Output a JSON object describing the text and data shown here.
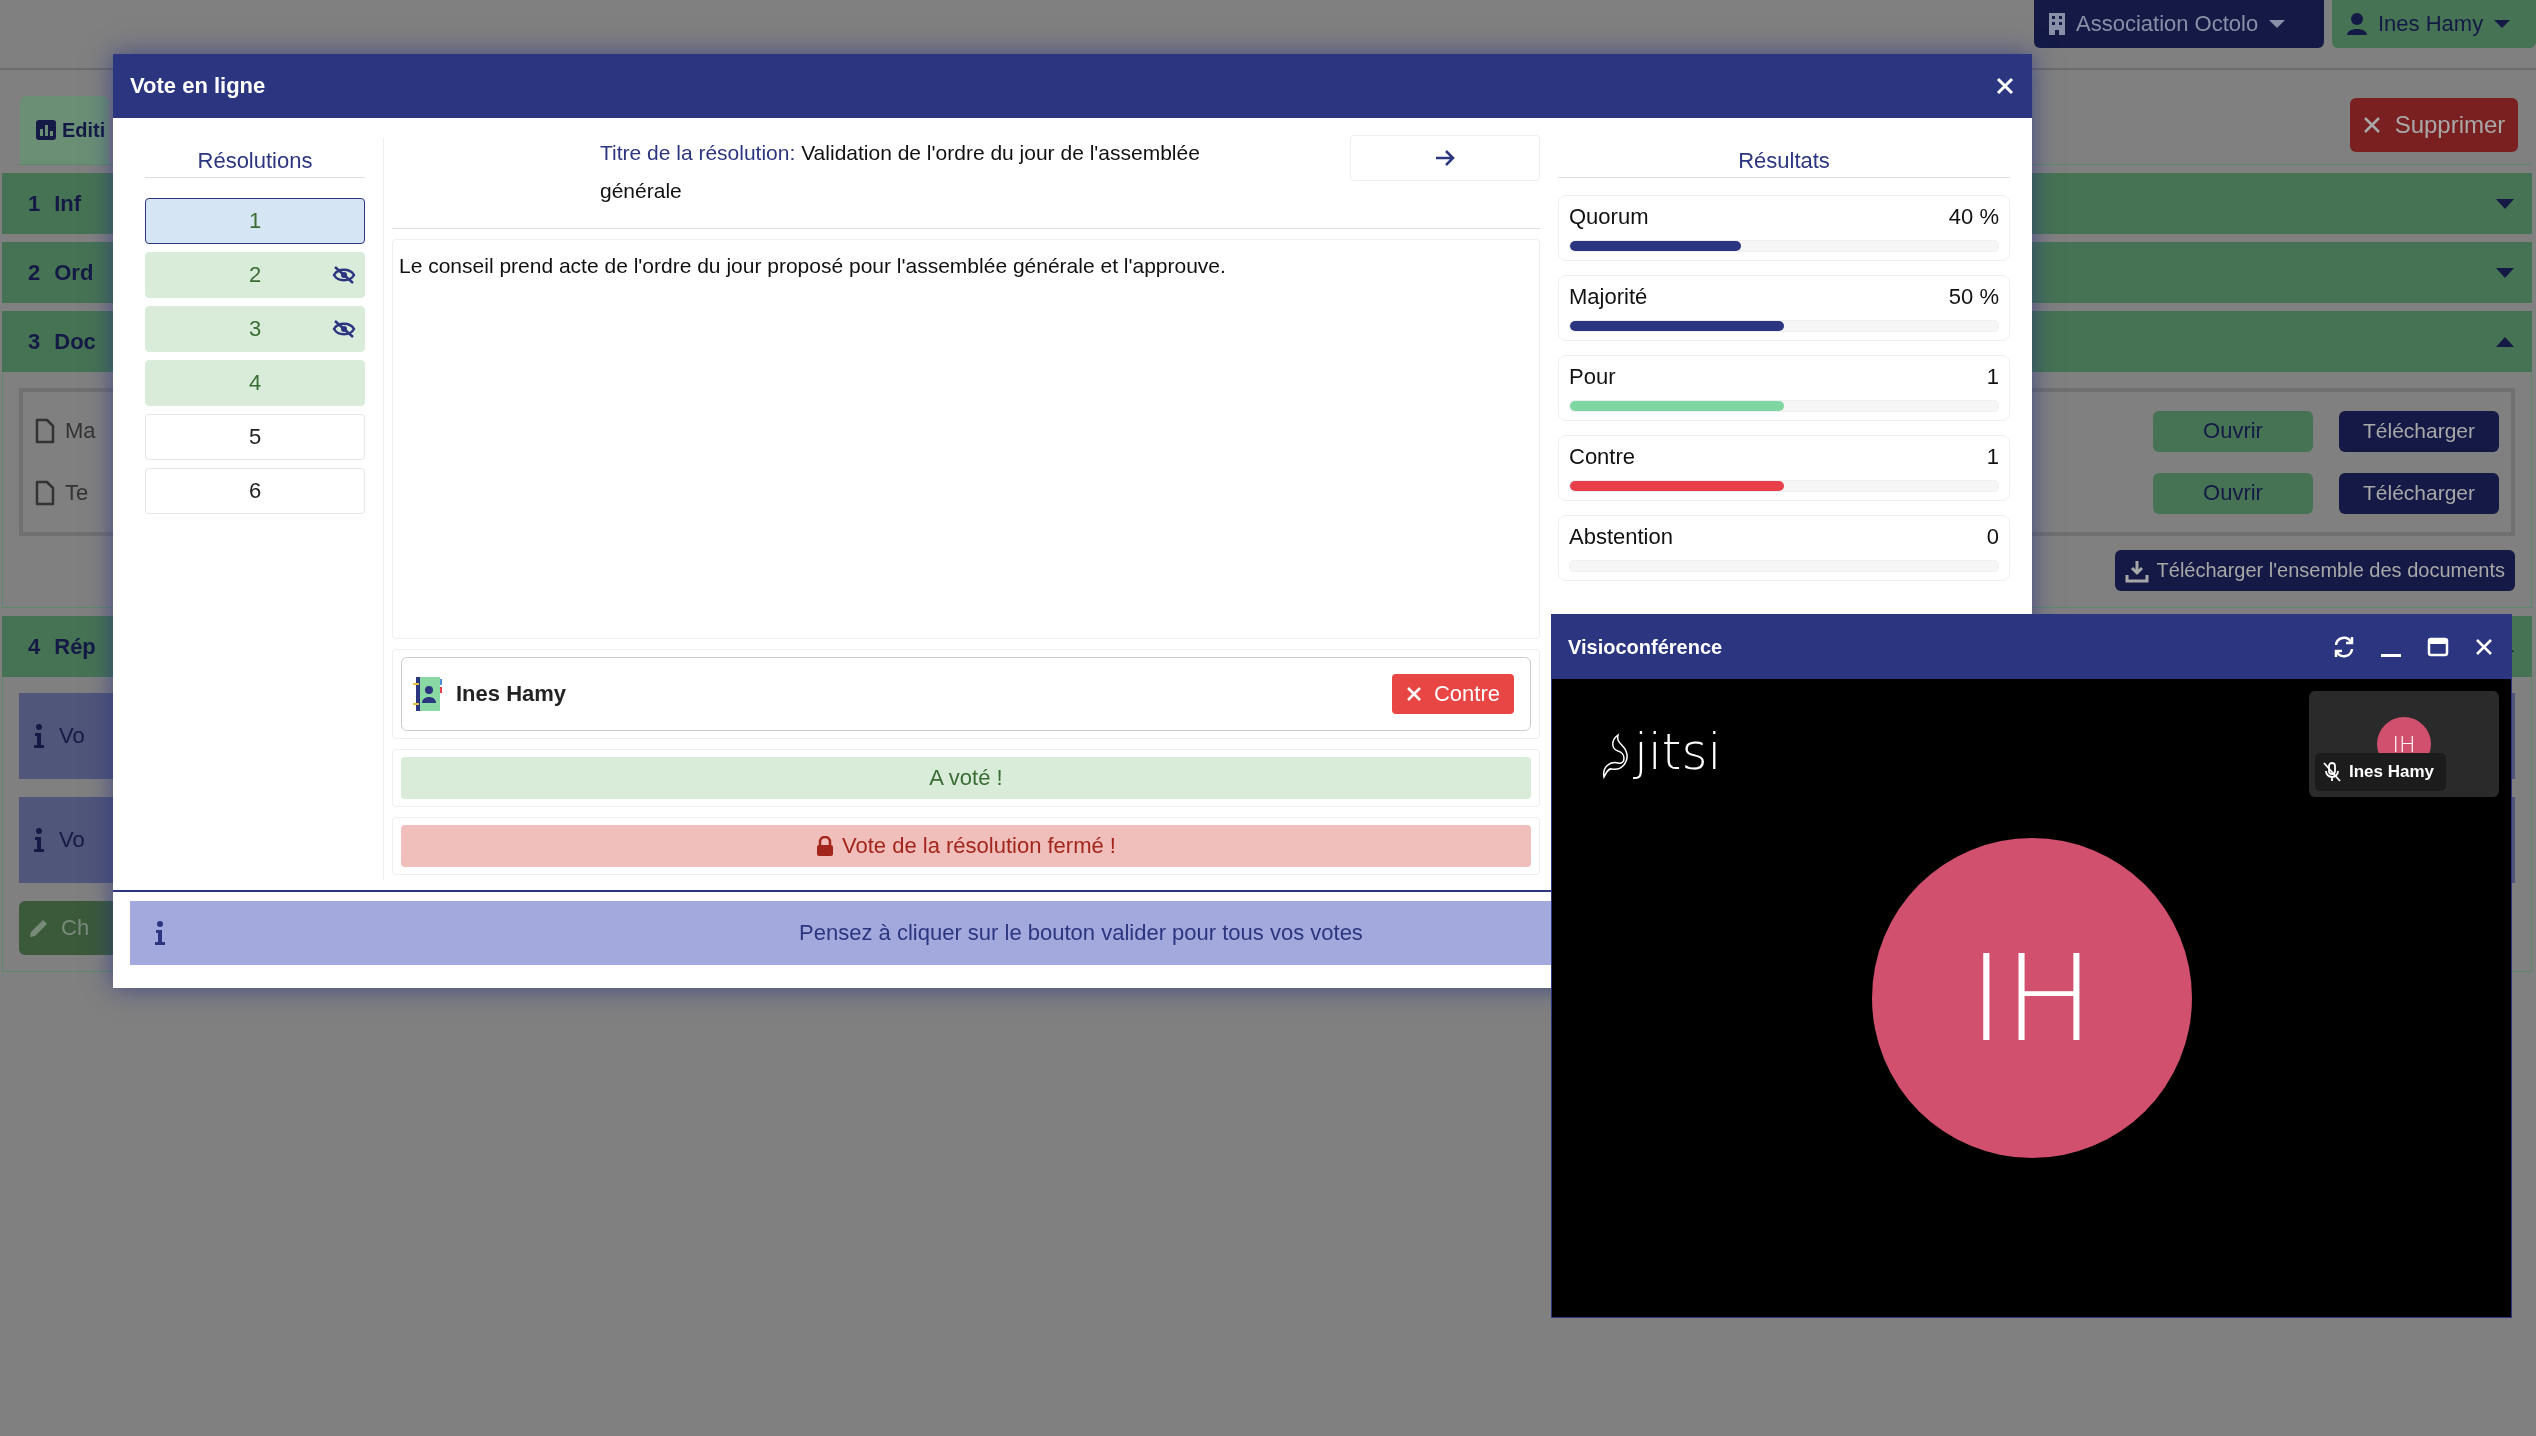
{
  "header": {
    "organization_button": "Association Octolo",
    "user_button": "Ines Hamy"
  },
  "page": {
    "tab": "Editi",
    "delete_button": "Supprimer",
    "sections": [
      {
        "number": "1",
        "label": "Inf",
        "expanded": false
      },
      {
        "number": "2",
        "label": "Ord",
        "expanded": false
      },
      {
        "number": "3",
        "label": "Doc",
        "expanded": true,
        "documents": [
          {
            "name": "Ma",
            "open": "Ouvrir",
            "download": "Télécharger"
          },
          {
            "name": "Te",
            "open": "Ouvrir",
            "download": "Télécharger"
          }
        ],
        "download_all": "Télécharger l'ensemble des documents"
      },
      {
        "number": "4",
        "label": "Rép",
        "expanded": true,
        "notices": [
          "Vo",
          "Vo"
        ],
        "edit_button": "Ch"
      }
    ]
  },
  "vote_modal": {
    "title": "Vote en ligne",
    "resolutions_heading": "Résolutions",
    "resolutions": [
      {
        "label": "1",
        "selected": true,
        "voted": true,
        "hidden": false
      },
      {
        "label": "2",
        "selected": false,
        "voted": true,
        "hidden": true
      },
      {
        "label": "3",
        "selected": false,
        "voted": true,
        "hidden": true
      },
      {
        "label": "4",
        "selected": false,
        "voted": true,
        "hidden": false
      },
      {
        "label": "5",
        "selected": false,
        "voted": false,
        "hidden": false
      },
      {
        "label": "6",
        "selected": false,
        "voted": false,
        "hidden": false
      }
    ],
    "title_label": "Titre de la résolution:",
    "title_value": "Validation de l'ordre du jour de l'assemblée générale",
    "description": "Le conseil prend acte de l'ordre du jour proposé pour l'assemblée générale et l'approuve.",
    "vote": {
      "voter": "Ines Hamy",
      "choice": "Contre"
    },
    "voted_message": "A voté !",
    "closed_message": "Vote de la résolution fermé !",
    "results_heading": "Résultats",
    "results": [
      {
        "label": "Quorum",
        "value": "40 %",
        "level": 0.4,
        "color": "#2c3580"
      },
      {
        "label": "Majorité",
        "value": "50 %",
        "level": 0.5,
        "color": "#2c3580"
      },
      {
        "label": "Pour",
        "value": "1",
        "level": 0.5,
        "color": "#7ed6a0"
      },
      {
        "label": "Contre",
        "value": "1",
        "level": 0.5,
        "color": "#e8404a"
      },
      {
        "label": "Abstention",
        "value": "0",
        "level": 0
      }
    ],
    "footer_notice": "Pensez à cliquer sur le bouton valider pour tous vos votes"
  },
  "video_window": {
    "title": "Visioconférence",
    "logo": "jitsi",
    "thumbnail": {
      "initials": "IH",
      "name": "Ines Hamy",
      "muted": true
    },
    "speaker_initials": "IH"
  }
}
